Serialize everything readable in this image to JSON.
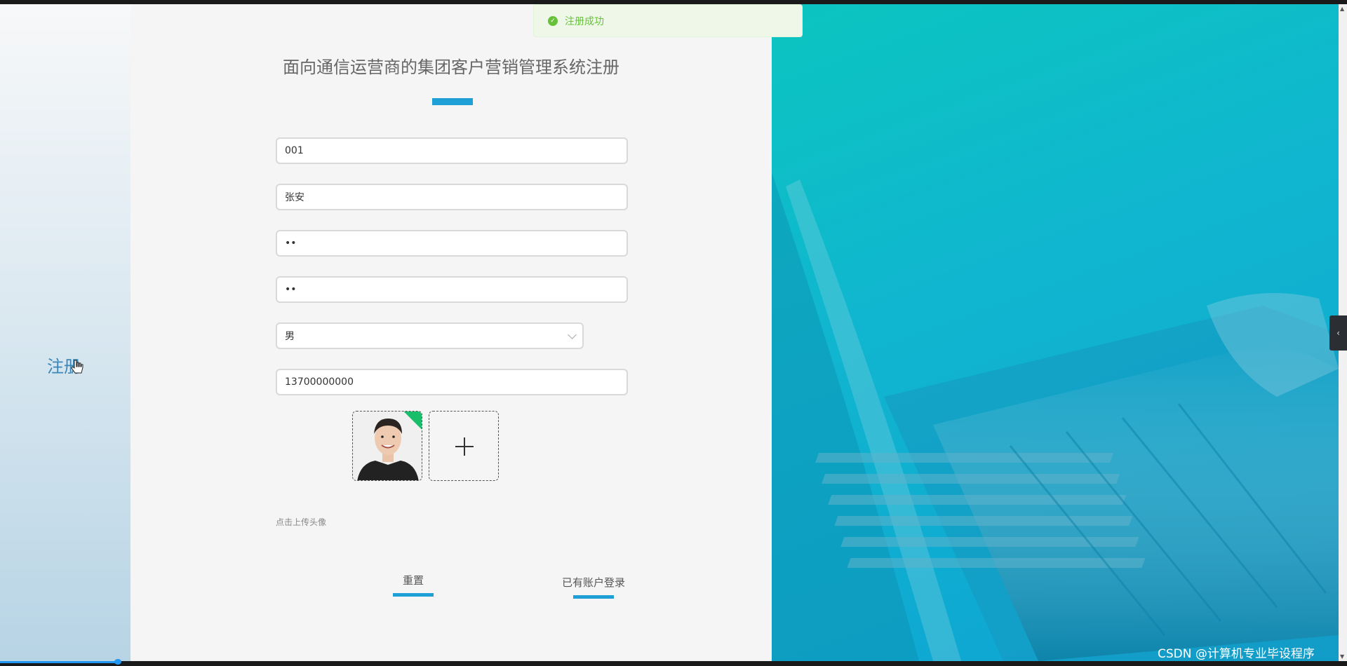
{
  "page": {
    "title": "面向通信运营商的集团客户营销管理系统注册",
    "nav_register": "注册"
  },
  "toast": {
    "message": "注册成功"
  },
  "form": {
    "account": "001",
    "name": "张安",
    "password": "••",
    "confirm_password": "••",
    "gender": "男",
    "phone": "13700000000",
    "upload_hint": "点击上传头像"
  },
  "buttons": {
    "reset": "重置",
    "login": "已有账户登录"
  },
  "watermark": "CSDN @计算机专业毕设程序",
  "colors": {
    "accent": "#1ea0d7",
    "success": "#67c23a",
    "hero_teal": "#10b6cf"
  }
}
